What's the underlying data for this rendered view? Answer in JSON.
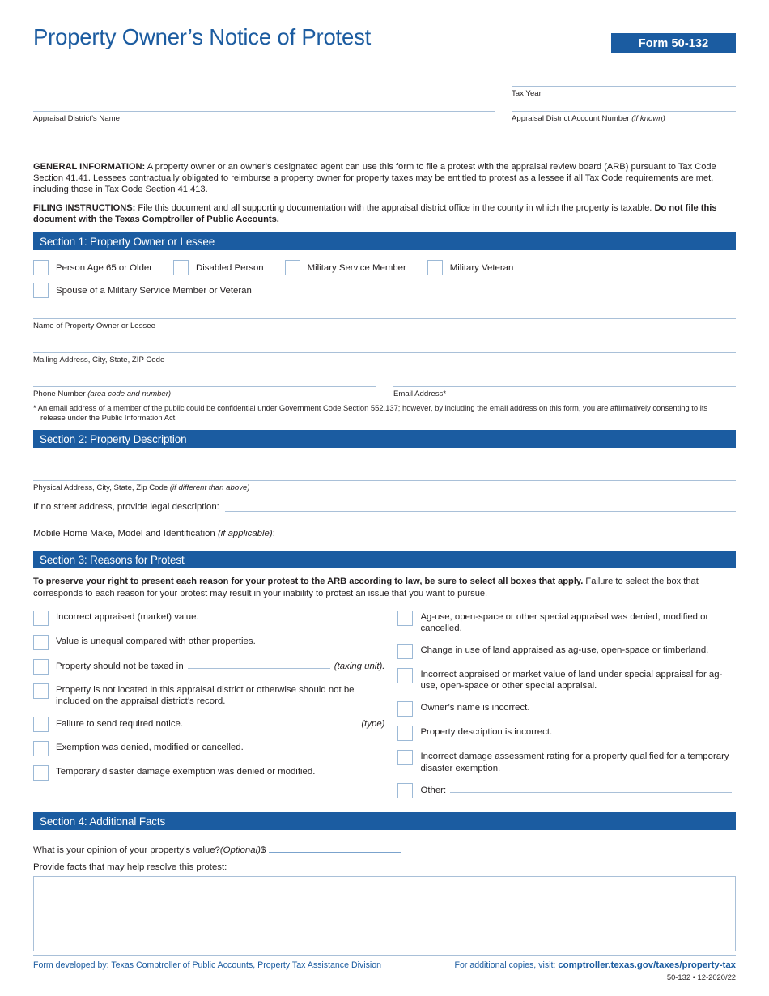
{
  "header": {
    "title": "Property Owner’s Notice of Protest",
    "form_badge": "Form 50-132",
    "badge_color": "#1b5ca1",
    "title_color": "#1c5ca0"
  },
  "top_fields": {
    "tax_year_label": "Tax Year",
    "appraisal_district_name_label": "Appraisal District’s Name",
    "account_number_label_main": "Appraisal District Account Number ",
    "account_number_label_italic": "(if known)"
  },
  "general": {
    "heading": "GENERAL INFORMATION:",
    "text": " A property owner or an owner’s designated agent can use this form to file a protest with the appraisal review board (ARB) pursuant to Tax Code Section 41.41. Lessees contractually obligated to reimburse a property owner for property taxes may be entitled to protest as a lessee if all Tax Code requirements are met, including those in Tax Code Section 41.413."
  },
  "filing": {
    "heading": "FILING INSTRUCTIONS:",
    "text": " File this document and all supporting documentation with the appraisal district office in the county in which the property is taxable. ",
    "bold_tail": "Do not file this document with the Texas Comptroller of Public Accounts."
  },
  "section1": {
    "bar": "Section 1: Property Owner or Lessee",
    "checkboxes_row1": [
      "Person Age 65 or Older",
      "Disabled Person",
      "Military Service Member",
      "Military Veteran"
    ],
    "checkboxes_row2": [
      "Spouse of a Military Service Member or Veteran"
    ],
    "name_label": "Name of Property Owner or Lessee",
    "mailing_label": "Mailing Address, City, State, ZIP Code",
    "phone_label_main": "Phone Number ",
    "phone_label_italic": "(area code and number)",
    "email_label": "Email Address*",
    "footnote_line1": "* An email address of a member of the public could be confidential under Government Code Section 552.137; however, by including the email address on this form, you are affirmatively consenting to its",
    "footnote_line2": "release under the Public Information Act."
  },
  "section2": {
    "bar": "Section 2: Property Description",
    "physical_label_main": "Physical Address, City, State, Zip Code ",
    "physical_label_italic": "(if different than above)",
    "legal_label": "If no street address, provide legal description:",
    "mobile_label_main": "Mobile Home Make, Model and Identification ",
    "mobile_label_italic": "(if applicable)",
    "mobile_label_tail": ":"
  },
  "section3": {
    "bar": "Section 3: Reasons for Protest",
    "intro_bold": "To preserve your right to present each reason for your protest to the ARB according to law, be sure to select all boxes that apply.",
    "intro_rest": " Failure to select the box that corresponds to each reason for your protest may result in your inability to protest an issue that you want to pursue.",
    "left_reasons": [
      {
        "type": "plain",
        "text": "Incorrect appraised (market) value."
      },
      {
        "type": "plain",
        "text": "Value is unequal compared with other properties."
      },
      {
        "type": "blank",
        "pre": "Property should not be taxed in",
        "post": "(taxing unit)."
      },
      {
        "type": "plain",
        "text": "Property is not located in this appraisal district or otherwise should not be included on the appraisal district’s record."
      },
      {
        "type": "blank",
        "pre": "Failure to send required notice.",
        "post": "(type)"
      },
      {
        "type": "plain",
        "text": "Exemption was denied, modified or cancelled."
      },
      {
        "type": "plain",
        "text": "Temporary disaster damage exemption was denied or modified."
      }
    ],
    "right_reasons": [
      {
        "type": "plain",
        "text": "Ag-use, open-space or other special appraisal was denied, modified or cancelled."
      },
      {
        "type": "plain",
        "text": "Change in use of land appraised as ag-use, open-space or timberland."
      },
      {
        "type": "plain",
        "text": "Incorrect appraised or market value of land under special appraisal for ag-use, open-space or other special appraisal."
      },
      {
        "type": "plain",
        "text": "Owner’s name is incorrect."
      },
      {
        "type": "plain",
        "text": "Property description is incorrect."
      },
      {
        "type": "plain",
        "text": "Incorrect damage assessment rating for a property qualified for a temporary disaster exemption."
      },
      {
        "type": "blank",
        "pre": "Other:",
        "post": ""
      }
    ]
  },
  "section4": {
    "bar": "Section 4: Additional Facts",
    "opinion_pre": "What is your opinion of your property’s value? ",
    "opinion_italic": "(Optional)",
    "opinion_dollar": " $",
    "provide_label": "Provide facts that may help resolve this protest:",
    "facts_value": ""
  },
  "footer": {
    "left": "Form developed by: Texas Comptroller of Public Accounts, Property Tax Assistance Division",
    "right_prefix": "For additional copies, visit: ",
    "right_link": "comptroller.texas.gov/taxes/property-tax",
    "form_id": "50-132 • 12-2020/22",
    "link_color": "#1c5ca0"
  }
}
